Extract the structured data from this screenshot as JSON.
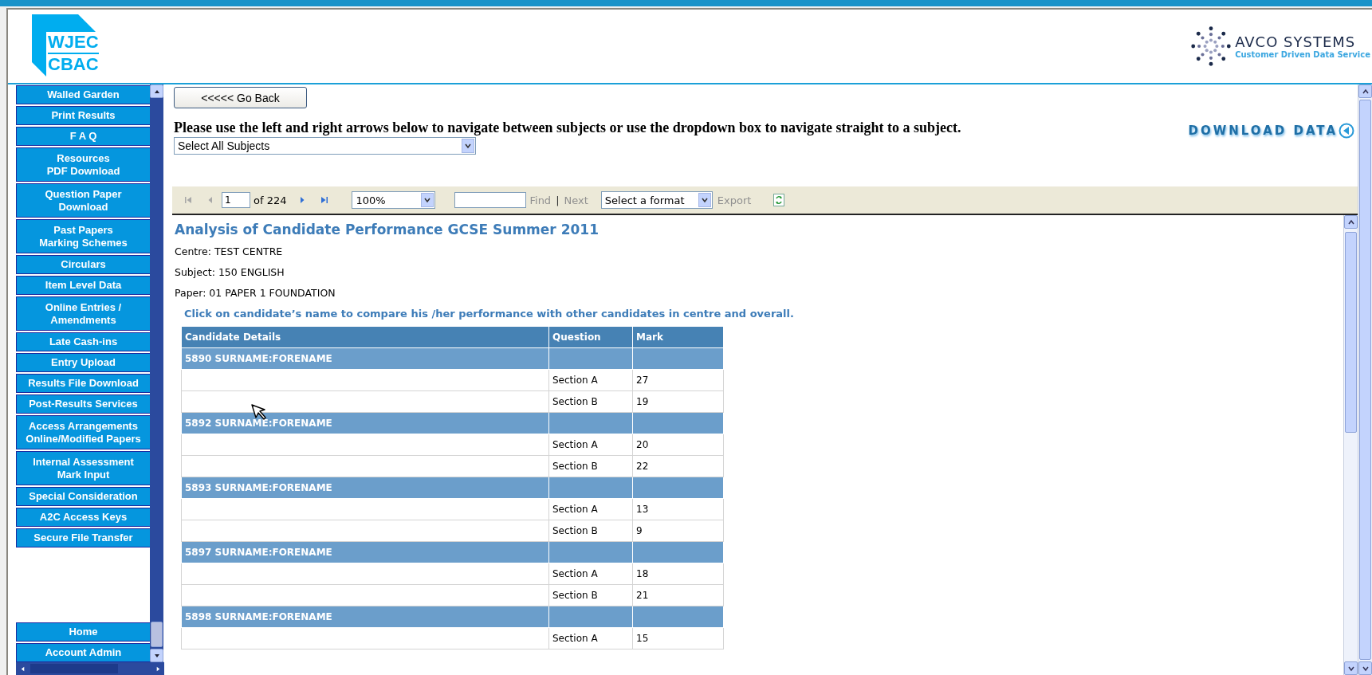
{
  "header": {
    "logo_top": "WJEC",
    "logo_bottom": "CBAC",
    "vendor_name": "AVCO SYSTEMS",
    "vendor_tagline": "Customer Driven Data Service"
  },
  "sidebar": {
    "items": [
      {
        "label": "Walled Garden"
      },
      {
        "label": "Print Results"
      },
      {
        "label": "F A Q"
      },
      {
        "label": "Resources\nPDF Download"
      },
      {
        "label": "Question Paper\nDownload"
      },
      {
        "label": "Past Papers\nMarking Schemes"
      },
      {
        "label": "Circulars"
      },
      {
        "label": "Item Level Data"
      },
      {
        "label": "Online Entries /\nAmendments"
      },
      {
        "label": "Late Cash-ins"
      },
      {
        "label": "Entry Upload"
      },
      {
        "label": "Results File Download"
      },
      {
        "label": "Post-Results Services"
      },
      {
        "label": "Access Arrangements\nOnline/Modified Papers"
      },
      {
        "label": "Internal Assessment\nMark Input"
      },
      {
        "label": "Special Consideration"
      },
      {
        "label": "A2C Access Keys"
      },
      {
        "label": "Secure File Transfer"
      }
    ],
    "bottom_items": [
      {
        "label": "Home"
      },
      {
        "label": "Account Admin"
      }
    ]
  },
  "go_back": "<<<<< Go Back",
  "instructions": "Please use the left and right arrows below to navigate between subjects or use the dropdown box to navigate straight to a subject.",
  "subject_select": "Select All Subjects",
  "download": "DOWNLOAD DATA",
  "toolbar": {
    "first_disabled": true,
    "prev_disabled": true,
    "next_disabled": false,
    "last_disabled": false,
    "page": "1",
    "page_count": "of 224",
    "zoom": "100%",
    "find": "Find",
    "separator": "|",
    "next": "Next",
    "format": "Select a format",
    "export": "Export",
    "find_disabled": true,
    "export_disabled": true
  },
  "report": {
    "title": "Analysis of Candidate Performance GCSE Summer 2011",
    "details": [
      "Centre: TEST CENTRE",
      "Subject: 150 ENGLISH",
      "Paper: 01 PAPER 1 FOUNDATION"
    ],
    "note": "Click on candidate’s name to compare his /her performance with other candidates in centre and overall.",
    "columns": [
      "Candidate Details",
      "Question",
      "Mark"
    ],
    "candidates": [
      {
        "name": "5890 SURNAME:FORENAME",
        "marks": [
          {
            "question": "Section A",
            "mark": "27"
          },
          {
            "question": "Section B",
            "mark": "19"
          }
        ]
      },
      {
        "name": "5892 SURNAME:FORENAME",
        "marks": [
          {
            "question": "Section A",
            "mark": "20"
          },
          {
            "question": "Section B",
            "mark": "22"
          }
        ]
      },
      {
        "name": "5893 SURNAME:FORENAME",
        "marks": [
          {
            "question": "Section A",
            "mark": "13"
          },
          {
            "question": "Section B",
            "mark": "9"
          }
        ]
      },
      {
        "name": "5897 SURNAME:FORENAME",
        "marks": [
          {
            "question": "Section A",
            "mark": "18"
          },
          {
            "question": "Section B",
            "mark": "21"
          }
        ]
      },
      {
        "name": "5898 SURNAME:FORENAME",
        "marks": [
          {
            "question": "Section A",
            "mark": "15"
          }
        ]
      }
    ]
  }
}
